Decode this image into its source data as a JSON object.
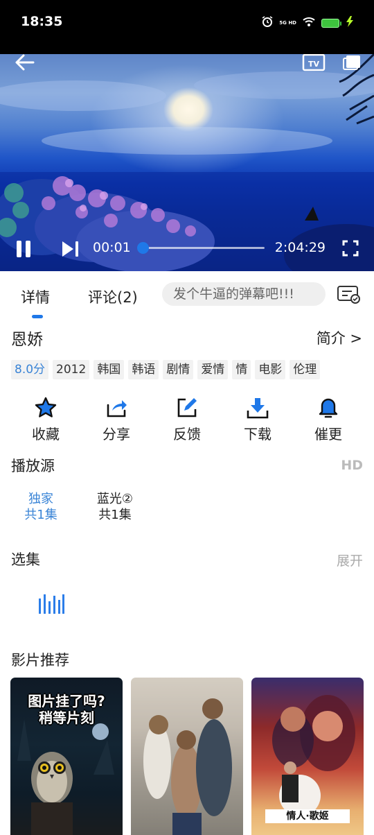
{
  "status_bar": {
    "time": "18:35",
    "network": "5G HD",
    "icons": [
      "alarm-icon",
      "signal-icon",
      "wifi-icon",
      "battery-icon",
      "charging-icon"
    ]
  },
  "player": {
    "current_time": "00:01",
    "total_time": "2:04:29",
    "progress": 0.0,
    "accent": "#1f78e8"
  },
  "tabs": {
    "detail": "详情",
    "comments": "评论(2)",
    "danmaku_placeholder": "发个牛逼的弹幕吧!!!"
  },
  "movie": {
    "title": "恩娇",
    "intro_link": "简介 >",
    "tags": [
      "8.0分",
      "2012",
      "韩国",
      "韩语",
      "剧情",
      "爱情",
      "情",
      "电影",
      "伦理"
    ]
  },
  "actions": [
    {
      "label": "收藏",
      "icon": "star-icon"
    },
    {
      "label": "分享",
      "icon": "share-icon"
    },
    {
      "label": "反馈",
      "icon": "edit-feedback-icon"
    },
    {
      "label": "下载",
      "icon": "download-icon"
    },
    {
      "label": "催更",
      "icon": "bell-icon"
    }
  ],
  "source": {
    "title": "播放源",
    "hd": "HD",
    "items": [
      {
        "name": "独家",
        "episodes": "共1集"
      },
      {
        "name": "蓝光②",
        "episodes": "共1集"
      }
    ]
  },
  "episodes": {
    "title": "选集",
    "expand": "展开"
  },
  "recommend": {
    "title": "影片推荐",
    "items": [
      {
        "overlay_line1": "图片挂了吗?",
        "overlay_line2": "稍等片刻"
      },
      {},
      {
        "poster_text": "情人·歌姬"
      }
    ]
  }
}
